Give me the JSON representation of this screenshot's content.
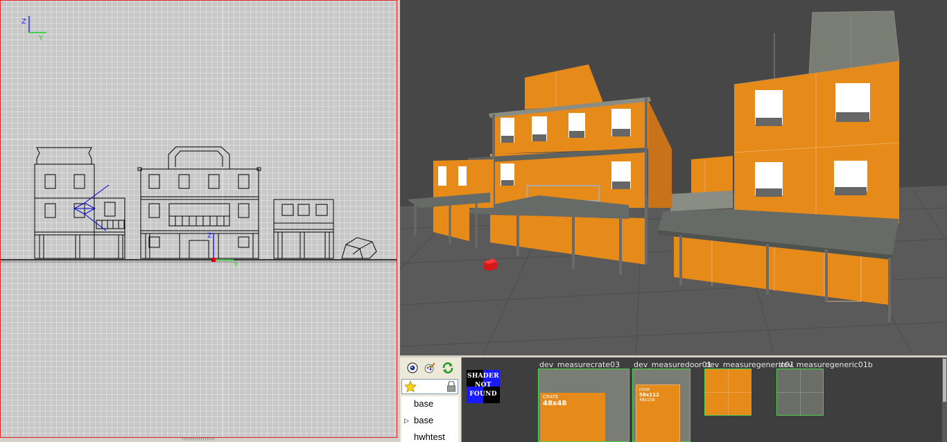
{
  "viewport_2d": {
    "axis_top": {
      "vertical": "Z",
      "horizontal": "Y"
    },
    "axis_origin": {
      "vertical": "Z",
      "horizontal": "Y"
    }
  },
  "texture_browser": {
    "shader_not_found": {
      "line1": "SHADER",
      "line2": "NOT",
      "line3": "FOUND"
    },
    "tree": [
      {
        "label": "base",
        "expandable": false
      },
      {
        "label": "base",
        "expandable": true
      },
      {
        "label": "hwhtest",
        "expandable": false
      }
    ],
    "textures": [
      {
        "name": "dev_measurecrate03",
        "label_top": "CRATE",
        "label_main": "48x48"
      },
      {
        "name": "dev_measuredoor01",
        "label_top": "DOOR",
        "label_main": "56x112",
        "label_sub": "48x108"
      },
      {
        "name": "dev_measuregeneric01"
      },
      {
        "name": "dev_measuregeneric01b"
      }
    ],
    "icons": [
      "camera-eye-icon",
      "edit-shader-icon",
      "refresh-icon",
      "favorite-star-icon",
      "lock-icon"
    ]
  },
  "colors": {
    "orange": "#e68a1a",
    "viewport_border": "#e02020",
    "selection_green": "#4fd04f"
  }
}
